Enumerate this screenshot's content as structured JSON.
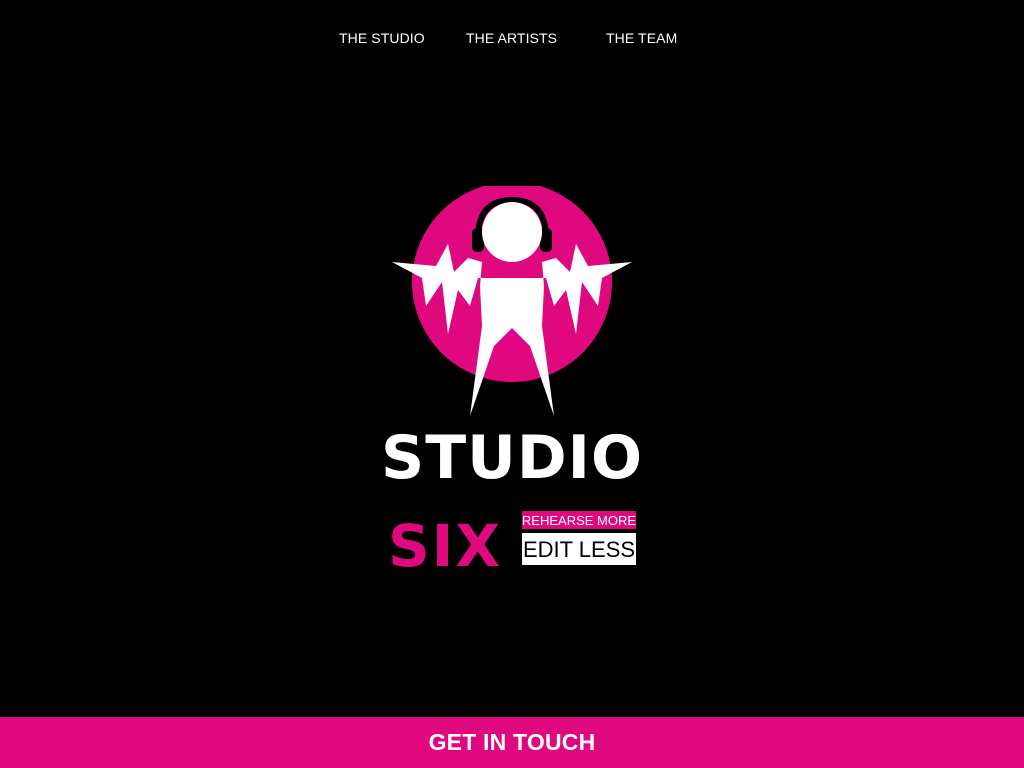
{
  "nav": {
    "items": [
      {
        "label": "THE STUDIO"
      },
      {
        "label": "THE ARTISTS"
      },
      {
        "label": "THE TEAM"
      }
    ]
  },
  "logo": {
    "wordmark_line1": "STUDIO",
    "wordmark_line2": "SIX",
    "tagline_top": "REHEARSE MORE",
    "tagline_bottom": "EDIT LESS",
    "icon": "headphones-figure-soundwave-icon"
  },
  "footer": {
    "cta_label": "GET IN TOUCH"
  },
  "colors": {
    "background": "#000000",
    "accent": "#e0087f",
    "text": "#ffffff"
  }
}
